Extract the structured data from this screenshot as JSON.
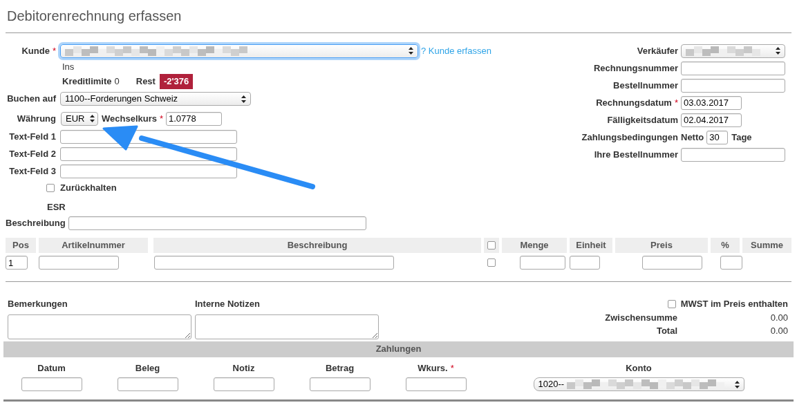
{
  "title": "Debitorenrechnung erfassen",
  "customer": {
    "label": "Kunde",
    "required_mark": "*",
    "focused": true,
    "link": "? Kunde erfassen",
    "name_line": "Ins",
    "credit_label": "Kreditlimite",
    "credit_value": "0",
    "rest_label": "Rest",
    "rest_value": "-2'376"
  },
  "left_fields": [
    {
      "kind": "select",
      "label": "Buchen auf",
      "value": "1100--Forderungen Schweiz"
    },
    {
      "kind": "currency",
      "label": "Währung",
      "value": "EUR",
      "rate_label": "Wechselkurs",
      "rate_required_mark": "*",
      "rate_value": "1.0778"
    },
    {
      "kind": "text",
      "label": "Text-Feld 1"
    },
    {
      "kind": "text",
      "label": "Text-Feld 2"
    },
    {
      "kind": "text",
      "label": "Text-Feld 3"
    }
  ],
  "hold": {
    "label": "Zurückhalten",
    "checked": false
  },
  "esr_label": "ESR",
  "description_label": "Beschreibung",
  "right_fields": [
    {
      "kind": "select",
      "label": "Verkäufer"
    },
    {
      "kind": "text",
      "label": "Rechnungsnummer"
    },
    {
      "kind": "text",
      "label": "Bestellnummer"
    },
    {
      "kind": "date",
      "label": "Rechnungsdatum",
      "required_mark": "*",
      "value": "03.03.2017"
    },
    {
      "kind": "date",
      "label": "Fälligkeitsdatum",
      "value": "02.04.2017"
    },
    {
      "kind": "terms",
      "label": "Zahlungsbedingungen",
      "prefix": "Netto",
      "value": "30",
      "suffix": "Tage"
    },
    {
      "kind": "text",
      "label": "Ihre Bestellnummer"
    }
  ],
  "table": {
    "columns": [
      {
        "kind": "text",
        "label": "Pos"
      },
      {
        "kind": "text",
        "label": "Artikelnummer"
      },
      {
        "kind": "text",
        "label": "Beschreibung"
      },
      {
        "kind": "checkbox",
        "checked": false
      },
      {
        "kind": "text",
        "label": "Menge"
      },
      {
        "kind": "text",
        "label": "Einheit"
      },
      {
        "kind": "text",
        "label": "Preis"
      },
      {
        "kind": "text",
        "label": "%"
      },
      {
        "kind": "text",
        "label": "Summe"
      }
    ],
    "rows": [
      [
        {
          "kind": "input",
          "value": "1"
        },
        {
          "kind": "input"
        },
        {
          "kind": "input"
        },
        {
          "kind": "checkbox",
          "checked": false
        },
        {
          "kind": "input"
        },
        {
          "kind": "input"
        },
        {
          "kind": "input"
        },
        {
          "kind": "input"
        },
        {
          "kind": "empty"
        }
      ]
    ]
  },
  "notes": [
    {
      "label": "Bemerkungen"
    },
    {
      "label": "Interne Notizen"
    }
  ],
  "vat": {
    "label": "MWST im Preis enthalten",
    "checked": false
  },
  "totals": [
    {
      "label": "Zwischensumme",
      "value": "0.00"
    },
    {
      "label": "Total",
      "value": "0.00"
    }
  ],
  "payments": {
    "title": "Zahlungen",
    "columns": [
      {
        "kind": "input",
        "label": "Datum"
      },
      {
        "kind": "input",
        "label": "Beleg"
      },
      {
        "kind": "input",
        "label": "Notiz"
      },
      {
        "kind": "input",
        "label": "Betrag"
      },
      {
        "kind": "input",
        "label": "Wkurs.",
        "required_mark": "*"
      },
      {
        "kind": "account",
        "label": "Konto",
        "value": "1020--"
      }
    ]
  }
}
